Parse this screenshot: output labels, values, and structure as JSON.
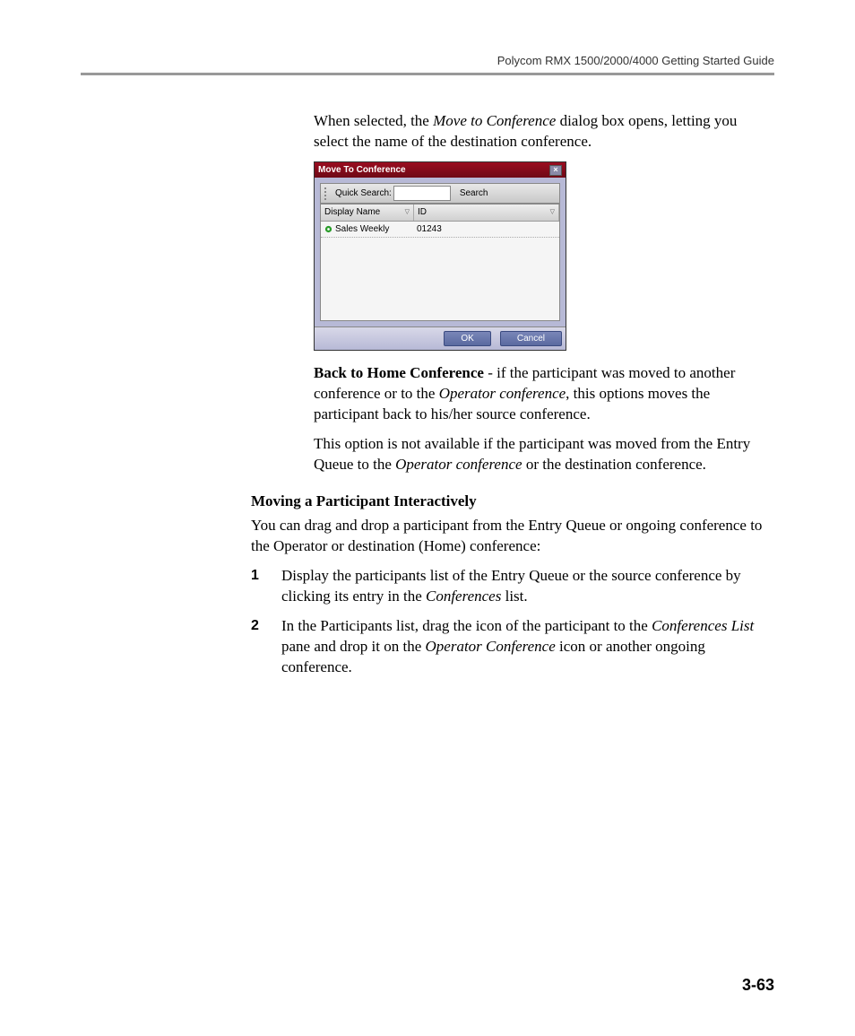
{
  "header": {
    "guide_title": "Polycom RMX 1500/2000/4000 Getting Started Guide"
  },
  "intro": {
    "p1_a": "When selected, the ",
    "p1_em": "Move to Conference",
    "p1_b": " dialog box opens, letting you select the name of the destination conference."
  },
  "dialog": {
    "title": "Move To Conference",
    "close_glyph": "×",
    "quick_search_label": "Quick Search:",
    "search_input_value": "",
    "search_btn": "Search",
    "col_display_name": "Display Name",
    "col_id": "ID",
    "rows": [
      {
        "name": "Sales Weekly",
        "id": "01243"
      }
    ],
    "ok": "OK",
    "cancel": "Cancel"
  },
  "back_home": {
    "heading": "Back to Home Conference",
    "p1_a": " - if the participant was moved to another conference or to the ",
    "p1_em": "Operator conference",
    "p1_b": ", this options moves the participant back to his/her source conference.",
    "p2_a": "This option is not available if the participant was moved from the Entry Queue to the ",
    "p2_em": "Operator conference",
    "p2_b": " or the destination conference."
  },
  "moving": {
    "heading": "Moving a Participant Interactively",
    "intro": "You can drag and drop a participant from the Entry Queue or ongoing conference to the Operator or destination (Home) conference:",
    "steps": [
      {
        "num": "1",
        "a": "Display the participants list of the Entry Queue or the source conference by clicking its entry in the ",
        "em1": "Conferences",
        "b": " list."
      },
      {
        "num": "2",
        "a": "In the Participants list, drag the icon of the participant to the ",
        "em1": "Conferences List",
        "b": " pane and drop it on the ",
        "em2": "Operator Conference",
        "c": " icon or another ongoing conference."
      }
    ]
  },
  "page_number": "3-63"
}
